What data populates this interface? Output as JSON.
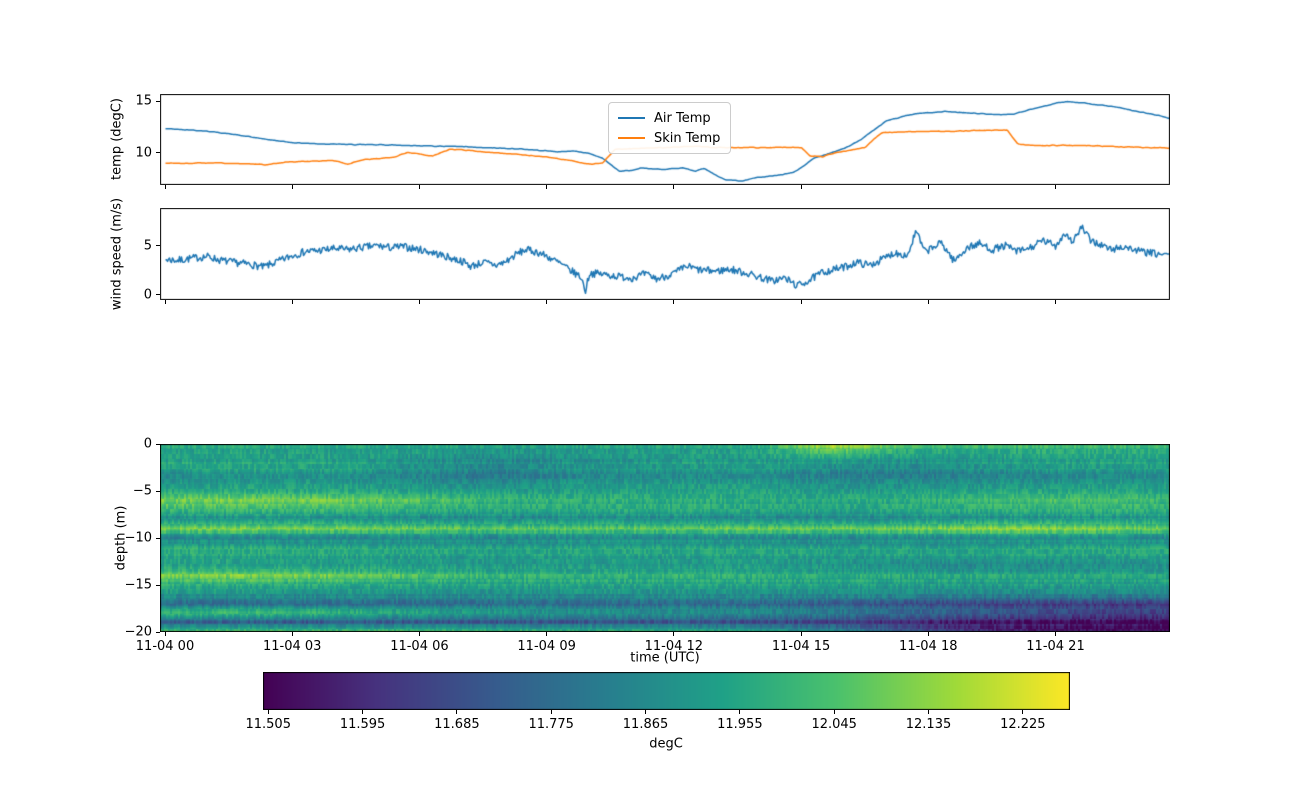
{
  "figure": {
    "background": "#ffffff",
    "accent_blue": "#1f77b4",
    "accent_orange": "#ff7f0e"
  },
  "temp_plot": {
    "ylabel": "temp (degC)",
    "legend_items": [
      {
        "label": "Air Temp",
        "color": "#1f77b4"
      },
      {
        "label": "Skin Temp",
        "color": "#ff7f0e"
      }
    ]
  },
  "wind_plot": {
    "ylabel": "wind speed (m/s)"
  },
  "heatmap_plot": {
    "ylabel": "depth (m)",
    "xlabel": "time (UTC)"
  },
  "colorbar": {
    "label": "degC"
  },
  "time_axis": {
    "tick_hours": [
      0,
      3,
      6,
      9,
      12,
      15,
      18,
      21
    ],
    "tick_labels": [
      "11-04 00",
      "11-04 03",
      "11-04 06",
      "11-04 09",
      "11-04 12",
      "11-04 15",
      "11-04 18",
      "11-04 21"
    ]
  },
  "chart_data": [
    {
      "type": "line",
      "name": "air-and-skin-temperature",
      "title": "",
      "ylabel": "temp (degC)",
      "x_unit": "hours since 11-04 00:00 UTC",
      "xlim_hours": [
        -0.118,
        23.7
      ],
      "ylim": [
        6.9,
        15.7
      ],
      "yticks": [
        {
          "value": 15,
          "label": "15"
        },
        {
          "value": 10,
          "label": "10"
        }
      ],
      "xticks_hours": [
        0,
        3,
        6,
        9,
        12,
        15,
        18,
        21
      ],
      "legend_position": "upper center",
      "series": [
        {
          "name": "Air Temp",
          "color": "#1f77b4",
          "noise_amp": 0.05,
          "noise_smooth": 2,
          "x": [
            0,
            0.5,
            1,
            1.5,
            2,
            2.5,
            3,
            3.5,
            4,
            4.5,
            5,
            5.5,
            6,
            6.5,
            7,
            7.5,
            8,
            8.5,
            9,
            9.3,
            9.6,
            10,
            10.3,
            10.7,
            11,
            11.2,
            11.5,
            11.8,
            12.2,
            12.5,
            12.7,
            13,
            13.2,
            13.6,
            13.9,
            14.4,
            14.8,
            15,
            15.3,
            15.6,
            15.9,
            16.1,
            16.4,
            16.7,
            17,
            17.4,
            17.7,
            18,
            18.4,
            18.8,
            19.2,
            19.6,
            20,
            20.4,
            20.8,
            21,
            21.3,
            21.6,
            22,
            22.4,
            22.8,
            23.2,
            23.5,
            23.7
          ],
          "y": [
            12.35,
            12.25,
            12.1,
            11.85,
            11.55,
            11.25,
            11.0,
            10.9,
            10.85,
            10.8,
            10.8,
            10.75,
            10.7,
            10.65,
            10.6,
            10.5,
            10.45,
            10.35,
            10.2,
            10.1,
            10.2,
            9.95,
            9.5,
            8.25,
            8.3,
            8.55,
            8.45,
            8.4,
            8.55,
            8.25,
            8.5,
            7.8,
            7.4,
            7.3,
            7.6,
            7.8,
            8.1,
            8.6,
            9.5,
            9.9,
            10.3,
            10.6,
            11.3,
            12.2,
            13.1,
            13.55,
            13.8,
            13.9,
            14.0,
            13.9,
            13.8,
            13.7,
            13.75,
            14.2,
            14.6,
            14.85,
            14.95,
            14.85,
            14.65,
            14.45,
            14.1,
            13.8,
            13.55,
            13.3
          ]
        },
        {
          "name": "Skin Temp",
          "color": "#ff7f0e",
          "noise_amp": 0.06,
          "noise_smooth": 2,
          "x": [
            0,
            0.5,
            1,
            1.5,
            2,
            2.4,
            2.7,
            3,
            3.5,
            4,
            4.3,
            4.6,
            5,
            5.4,
            5.7,
            6,
            6.3,
            6.7,
            7,
            7.5,
            8,
            8.5,
            9,
            9.5,
            10,
            10.3,
            10.6,
            10.9,
            11.2,
            12,
            12.5,
            13,
            13.5,
            14,
            14.5,
            15,
            15.2,
            15.5,
            15.8,
            16.2,
            16.5,
            16.7,
            16.9,
            17.1,
            17.5,
            18,
            18.5,
            19,
            19.5,
            19.85,
            20.0,
            20.1,
            20.4,
            20.8,
            21.2,
            21.6,
            22,
            22.5,
            23,
            23.4,
            23.7
          ],
          "y": [
            9.0,
            9.0,
            9.05,
            9.0,
            8.95,
            8.85,
            9.05,
            9.15,
            9.2,
            9.25,
            8.9,
            9.3,
            9.45,
            9.6,
            10.05,
            9.9,
            9.7,
            10.35,
            10.3,
            10.1,
            9.95,
            9.8,
            9.6,
            9.3,
            8.9,
            9.0,
            10.35,
            10.4,
            10.45,
            10.55,
            10.65,
            10.5,
            10.55,
            10.5,
            10.55,
            10.5,
            9.7,
            9.65,
            10.0,
            10.3,
            10.55,
            11.3,
            11.95,
            12.0,
            12.05,
            12.1,
            12.1,
            12.15,
            12.18,
            12.2,
            11.4,
            10.85,
            10.75,
            10.7,
            10.75,
            10.72,
            10.68,
            10.6,
            10.55,
            10.5,
            10.45
          ]
        }
      ]
    },
    {
      "type": "line",
      "name": "wind-speed",
      "title": "",
      "ylabel": "wind speed (m/s)",
      "x_unit": "hours since 11-04 00:00 UTC",
      "xlim_hours": [
        -0.118,
        23.7
      ],
      "ylim": [
        -0.55,
        8.85
      ],
      "yticks": [
        {
          "value": 5,
          "label": "5"
        },
        {
          "value": 0,
          "label": "0"
        }
      ],
      "xticks_hours": [
        0,
        3,
        6,
        9,
        12,
        15,
        18,
        21
      ],
      "series": [
        {
          "name": "wind speed",
          "color": "#1f77b4",
          "noise_amp": 0.38,
          "noise_smooth": 0,
          "x": [
            0,
            0.3,
            0.6,
            1,
            1.3,
            1.6,
            2,
            2.3,
            2.6,
            3,
            3.3,
            3.6,
            4,
            4.3,
            4.6,
            5,
            5.3,
            5.6,
            6,
            6.3,
            6.6,
            7,
            7.2,
            7.5,
            7.8,
            8,
            8.3,
            8.5,
            8.8,
            9,
            9.3,
            9.5,
            9.8,
            9.9,
            10,
            10.3,
            10.6,
            11,
            11.3,
            11.6,
            12,
            12.3,
            12.6,
            13,
            13.3,
            13.7,
            14,
            14.3,
            14.6,
            14.9,
            15.2,
            15.5,
            15.8,
            16,
            16.3,
            16.6,
            16.9,
            17.2,
            17.5,
            17.7,
            17.9,
            18.1,
            18.3,
            18.6,
            18.9,
            19.2,
            19.5,
            19.8,
            20.1,
            20.4,
            20.7,
            21,
            21.2,
            21.4,
            21.6,
            21.8,
            22,
            22.3,
            22.6,
            23,
            23.3,
            23.6,
            23.7
          ],
          "y": [
            3.6,
            3.5,
            3.7,
            3.9,
            3.5,
            3.3,
            3.1,
            2.8,
            3.3,
            4.0,
            4.4,
            4.5,
            4.7,
            4.6,
            4.8,
            5.0,
            4.8,
            4.9,
            4.6,
            4.3,
            3.9,
            3.4,
            2.9,
            3.3,
            3.0,
            3.3,
            4.2,
            4.6,
            4.3,
            3.9,
            3.2,
            2.6,
            1.8,
            0.35,
            2.2,
            2.1,
            1.9,
            1.7,
            2.1,
            1.6,
            2.2,
            2.9,
            2.5,
            2.4,
            2.6,
            2.2,
            1.8,
            1.4,
            1.7,
            0.9,
            1.5,
            2.3,
            2.6,
            2.8,
            3.3,
            3.0,
            3.6,
            4.3,
            4.0,
            6.5,
            4.4,
            4.8,
            5.3,
            3.4,
            4.8,
            5.2,
            4.6,
            5.0,
            4.4,
            4.8,
            5.5,
            5.0,
            6.3,
            5.4,
            6.9,
            5.6,
            5.2,
            4.6,
            4.9,
            4.4,
            4.2,
            4.0,
            4.4
          ]
        }
      ]
    },
    {
      "type": "heatmap",
      "name": "water-temperature-depth-profile",
      "xlabel": "time (UTC)",
      "ylabel": "depth (m)",
      "colormap": "viridis",
      "vmin": 11.5,
      "vmax": 12.27,
      "xlim_hours": [
        -0.118,
        23.7
      ],
      "x_hours": [
        0,
        2,
        4,
        6,
        8,
        10,
        12,
        14,
        16,
        18,
        20,
        22,
        24
      ],
      "depths": [
        0,
        -1,
        -2,
        -3,
        -4,
        -5,
        -6,
        -7,
        -8,
        -9,
        -10,
        -11,
        -12,
        -13,
        -14,
        -15,
        -16,
        -17,
        -18,
        -19,
        -20
      ],
      "values": [
        [
          11.97,
          11.97,
          11.96,
          11.96,
          11.95,
          11.96,
          11.96,
          11.96,
          12.22,
          12.04,
          12.03,
          12.04,
          12.02
        ],
        [
          11.94,
          11.95,
          11.94,
          11.93,
          11.9,
          11.92,
          11.93,
          11.94,
          12.02,
          11.95,
          11.96,
          11.97,
          11.96
        ],
        [
          11.95,
          11.96,
          11.95,
          11.9,
          11.86,
          11.9,
          11.92,
          11.93,
          11.9,
          11.88,
          11.92,
          11.94,
          11.93
        ],
        [
          11.91,
          11.93,
          11.92,
          11.88,
          11.84,
          11.88,
          11.9,
          11.9,
          11.85,
          11.85,
          11.88,
          11.9,
          11.9
        ],
        [
          11.88,
          11.89,
          11.9,
          11.86,
          11.84,
          11.88,
          11.89,
          11.89,
          11.86,
          11.86,
          11.87,
          11.88,
          11.89
        ],
        [
          11.97,
          11.98,
          11.97,
          11.95,
          11.93,
          11.94,
          11.95,
          11.95,
          11.93,
          11.94,
          11.96,
          11.97,
          11.96
        ],
        [
          12.12,
          12.13,
          12.12,
          12.08,
          12.02,
          12.0,
          12.0,
          11.99,
          11.98,
          12.0,
          12.04,
          12.06,
          12.03
        ],
        [
          11.99,
          12.0,
          11.99,
          11.97,
          11.95,
          11.95,
          11.96,
          11.95,
          11.93,
          11.95,
          11.97,
          11.98,
          11.97
        ],
        [
          11.88,
          11.89,
          11.88,
          11.87,
          11.86,
          11.87,
          11.87,
          11.87,
          11.86,
          11.87,
          11.89,
          11.9,
          11.9
        ],
        [
          12.12,
          12.13,
          12.12,
          12.1,
          12.08,
          12.08,
          12.09,
          12.1,
          12.1,
          12.12,
          12.16,
          12.14,
          12.1
        ],
        [
          11.84,
          11.85,
          11.85,
          11.86,
          11.85,
          11.86,
          11.86,
          11.86,
          11.85,
          11.86,
          11.87,
          11.87,
          11.86
        ],
        [
          11.97,
          11.97,
          11.96,
          11.95,
          11.94,
          11.95,
          11.95,
          11.95,
          11.94,
          11.94,
          11.95,
          11.96,
          11.95
        ],
        [
          11.95,
          11.95,
          11.94,
          11.93,
          11.92,
          11.93,
          11.93,
          11.93,
          11.92,
          11.92,
          11.93,
          11.93,
          11.93
        ],
        [
          11.93,
          11.93,
          11.92,
          11.91,
          11.9,
          11.91,
          11.91,
          11.91,
          11.89,
          11.86,
          11.85,
          11.86,
          11.87
        ],
        [
          12.1,
          12.11,
          12.09,
          12.04,
          12.0,
          11.99,
          11.99,
          11.98,
          11.97,
          11.96,
          11.96,
          11.96,
          11.95
        ],
        [
          11.97,
          11.97,
          11.96,
          11.95,
          11.94,
          11.94,
          11.94,
          11.94,
          11.93,
          11.92,
          11.92,
          11.92,
          11.92
        ],
        [
          11.9,
          11.9,
          11.89,
          11.89,
          11.88,
          11.89,
          11.89,
          11.89,
          11.88,
          11.87,
          11.86,
          11.86,
          11.86
        ],
        [
          11.77,
          11.77,
          11.77,
          11.77,
          11.77,
          11.77,
          11.77,
          11.76,
          11.72,
          11.68,
          11.66,
          11.64,
          11.63
        ],
        [
          12.03,
          12.04,
          12.02,
          11.97,
          11.93,
          11.91,
          11.9,
          11.88,
          11.84,
          11.78,
          11.72,
          11.68,
          11.66
        ],
        [
          11.72,
          11.72,
          11.71,
          11.71,
          11.7,
          11.7,
          11.7,
          11.68,
          11.64,
          11.58,
          11.54,
          11.52,
          11.51
        ],
        [
          12.08,
          12.08,
          12.07,
          12.06,
          12.05,
          12.04,
          12.02,
          11.98,
          11.9,
          11.72,
          11.6,
          11.55,
          11.53
        ]
      ],
      "yticks": [
        {
          "value": 0,
          "label": "0"
        },
        {
          "value": -5,
          "label": "−5"
        },
        {
          "value": -10,
          "label": "−10"
        },
        {
          "value": -15,
          "label": "−15"
        },
        {
          "value": -20,
          "label": "−20"
        }
      ],
      "xticks": {
        "hours": [
          0,
          3,
          6,
          9,
          12,
          15,
          18,
          21
        ],
        "labels": [
          "11-04 00",
          "11-04 03",
          "11-04 06",
          "11-04 09",
          "11-04 12",
          "11-04 15",
          "11-04 18",
          "11-04 21"
        ]
      },
      "colorbar": {
        "label": "degC",
        "ticks": [
          11.505,
          11.595,
          11.685,
          11.775,
          11.865,
          11.955,
          12.045,
          12.135,
          12.225
        ]
      }
    }
  ]
}
